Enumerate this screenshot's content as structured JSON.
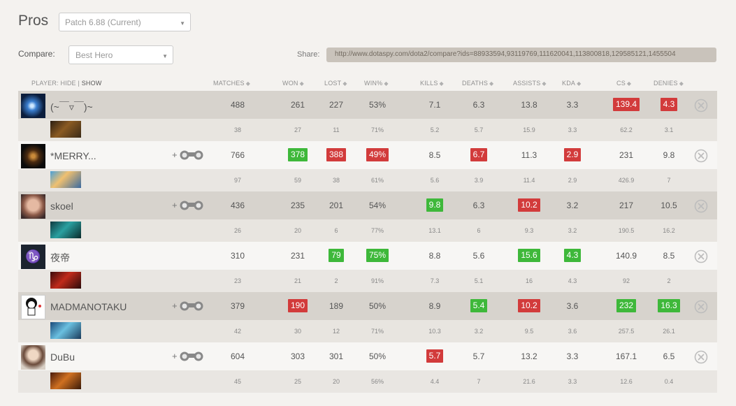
{
  "page_title": "Pros",
  "patch": {
    "value": "Patch 6.88 (Current)"
  },
  "compare": {
    "label": "Compare:",
    "value": "Best Hero"
  },
  "share": {
    "label": "Share:",
    "url": "http://www.dotaspy.com/dota2/compare?ids=88933594,93119769,111620041,113800818,129585121,1455504"
  },
  "header": {
    "player": "PLAYER:",
    "hide": "HIDE",
    "sep": "|",
    "show": "SHOW",
    "matches": "MATCHES",
    "won": "WON",
    "lost": "LOST",
    "win": "WIN%",
    "kills": "KILLS",
    "deaths": "DEATHS",
    "assists": "ASSISTS",
    "kda": "KDA",
    "cs": "CS",
    "denies": "DENIES"
  },
  "colors": {
    "green": "#3eb83a",
    "red": "#d23b3b"
  },
  "players": [
    {
      "name": "(~￣▿￣)~",
      "binoculars": false,
      "stats": {
        "matches": {
          "v": "488",
          "c": ""
        },
        "won": {
          "v": "261",
          "c": ""
        },
        "lost": {
          "v": "227",
          "c": ""
        },
        "win": {
          "v": "53%",
          "c": ""
        },
        "kills": {
          "v": "7.1",
          "c": ""
        },
        "deaths": {
          "v": "6.3",
          "c": ""
        },
        "assists": {
          "v": "13.8",
          "c": ""
        },
        "kda": {
          "v": "3.3",
          "c": ""
        },
        "cs": {
          "v": "139.4",
          "c": "red"
        },
        "denies": {
          "v": "4.3",
          "c": "red"
        }
      },
      "hero_stats": [
        "38",
        "27",
        "11",
        "71%",
        "5.2",
        "5.7",
        "15.9",
        "3.3",
        "62.2",
        "3.1"
      ]
    },
    {
      "name": "*MERRY...",
      "binoculars": true,
      "stats": {
        "matches": {
          "v": "766",
          "c": ""
        },
        "won": {
          "v": "378",
          "c": "green"
        },
        "lost": {
          "v": "388",
          "c": "red"
        },
        "win": {
          "v": "49%",
          "c": "red"
        },
        "kills": {
          "v": "8.5",
          "c": ""
        },
        "deaths": {
          "v": "6.7",
          "c": "red"
        },
        "assists": {
          "v": "11.3",
          "c": ""
        },
        "kda": {
          "v": "2.9",
          "c": "red"
        },
        "cs": {
          "v": "231",
          "c": ""
        },
        "denies": {
          "v": "9.8",
          "c": ""
        }
      },
      "hero_stats": [
        "97",
        "59",
        "38",
        "61%",
        "5.6",
        "3.9",
        "11.4",
        "2.9",
        "426.9",
        "7"
      ]
    },
    {
      "name": "skoel",
      "binoculars": true,
      "stats": {
        "matches": {
          "v": "436",
          "c": ""
        },
        "won": {
          "v": "235",
          "c": ""
        },
        "lost": {
          "v": "201",
          "c": ""
        },
        "win": {
          "v": "54%",
          "c": ""
        },
        "kills": {
          "v": "9.8",
          "c": "green"
        },
        "deaths": {
          "v": "6.3",
          "c": ""
        },
        "assists": {
          "v": "10.2",
          "c": "red"
        },
        "kda": {
          "v": "3.2",
          "c": ""
        },
        "cs": {
          "v": "217",
          "c": ""
        },
        "denies": {
          "v": "10.5",
          "c": ""
        }
      },
      "hero_stats": [
        "26",
        "20",
        "6",
        "77%",
        "13.1",
        "6",
        "9.3",
        "3.2",
        "190.5",
        "16.2"
      ]
    },
    {
      "name": "夜帝",
      "binoculars": false,
      "stats": {
        "matches": {
          "v": "310",
          "c": ""
        },
        "won": {
          "v": "231",
          "c": ""
        },
        "lost": {
          "v": "79",
          "c": "green"
        },
        "win": {
          "v": "75%",
          "c": "green"
        },
        "kills": {
          "v": "8.8",
          "c": ""
        },
        "deaths": {
          "v": "5.6",
          "c": ""
        },
        "assists": {
          "v": "15.6",
          "c": "green"
        },
        "kda": {
          "v": "4.3",
          "c": "green"
        },
        "cs": {
          "v": "140.9",
          "c": ""
        },
        "denies": {
          "v": "8.5",
          "c": ""
        }
      },
      "hero_stats": [
        "23",
        "21",
        "2",
        "91%",
        "7.3",
        "5.1",
        "16",
        "4.3",
        "92",
        "2"
      ]
    },
    {
      "name": "MADMANOTAKU",
      "binoculars": true,
      "stats": {
        "matches": {
          "v": "379",
          "c": ""
        },
        "won": {
          "v": "190",
          "c": "red"
        },
        "lost": {
          "v": "189",
          "c": ""
        },
        "win": {
          "v": "50%",
          "c": ""
        },
        "kills": {
          "v": "8.9",
          "c": ""
        },
        "deaths": {
          "v": "5.4",
          "c": "green"
        },
        "assists": {
          "v": "10.2",
          "c": "red"
        },
        "kda": {
          "v": "3.6",
          "c": ""
        },
        "cs": {
          "v": "232",
          "c": "green"
        },
        "denies": {
          "v": "16.3",
          "c": "green"
        }
      },
      "hero_stats": [
        "42",
        "30",
        "12",
        "71%",
        "10.3",
        "3.2",
        "9.5",
        "3.6",
        "257.5",
        "26.1"
      ]
    },
    {
      "name": "DuBu",
      "binoculars": true,
      "stats": {
        "matches": {
          "v": "604",
          "c": ""
        },
        "won": {
          "v": "303",
          "c": ""
        },
        "lost": {
          "v": "301",
          "c": ""
        },
        "win": {
          "v": "50%",
          "c": ""
        },
        "kills": {
          "v": "5.7",
          "c": "red"
        },
        "deaths": {
          "v": "5.7",
          "c": ""
        },
        "assists": {
          "v": "13.2",
          "c": ""
        },
        "kda": {
          "v": "3.3",
          "c": ""
        },
        "cs": {
          "v": "167.1",
          "c": ""
        },
        "denies": {
          "v": "6.5",
          "c": ""
        }
      },
      "hero_stats": [
        "45",
        "25",
        "20",
        "56%",
        "4.4",
        "7",
        "21.6",
        "3.3",
        "12.6",
        "0.4"
      ]
    }
  ]
}
